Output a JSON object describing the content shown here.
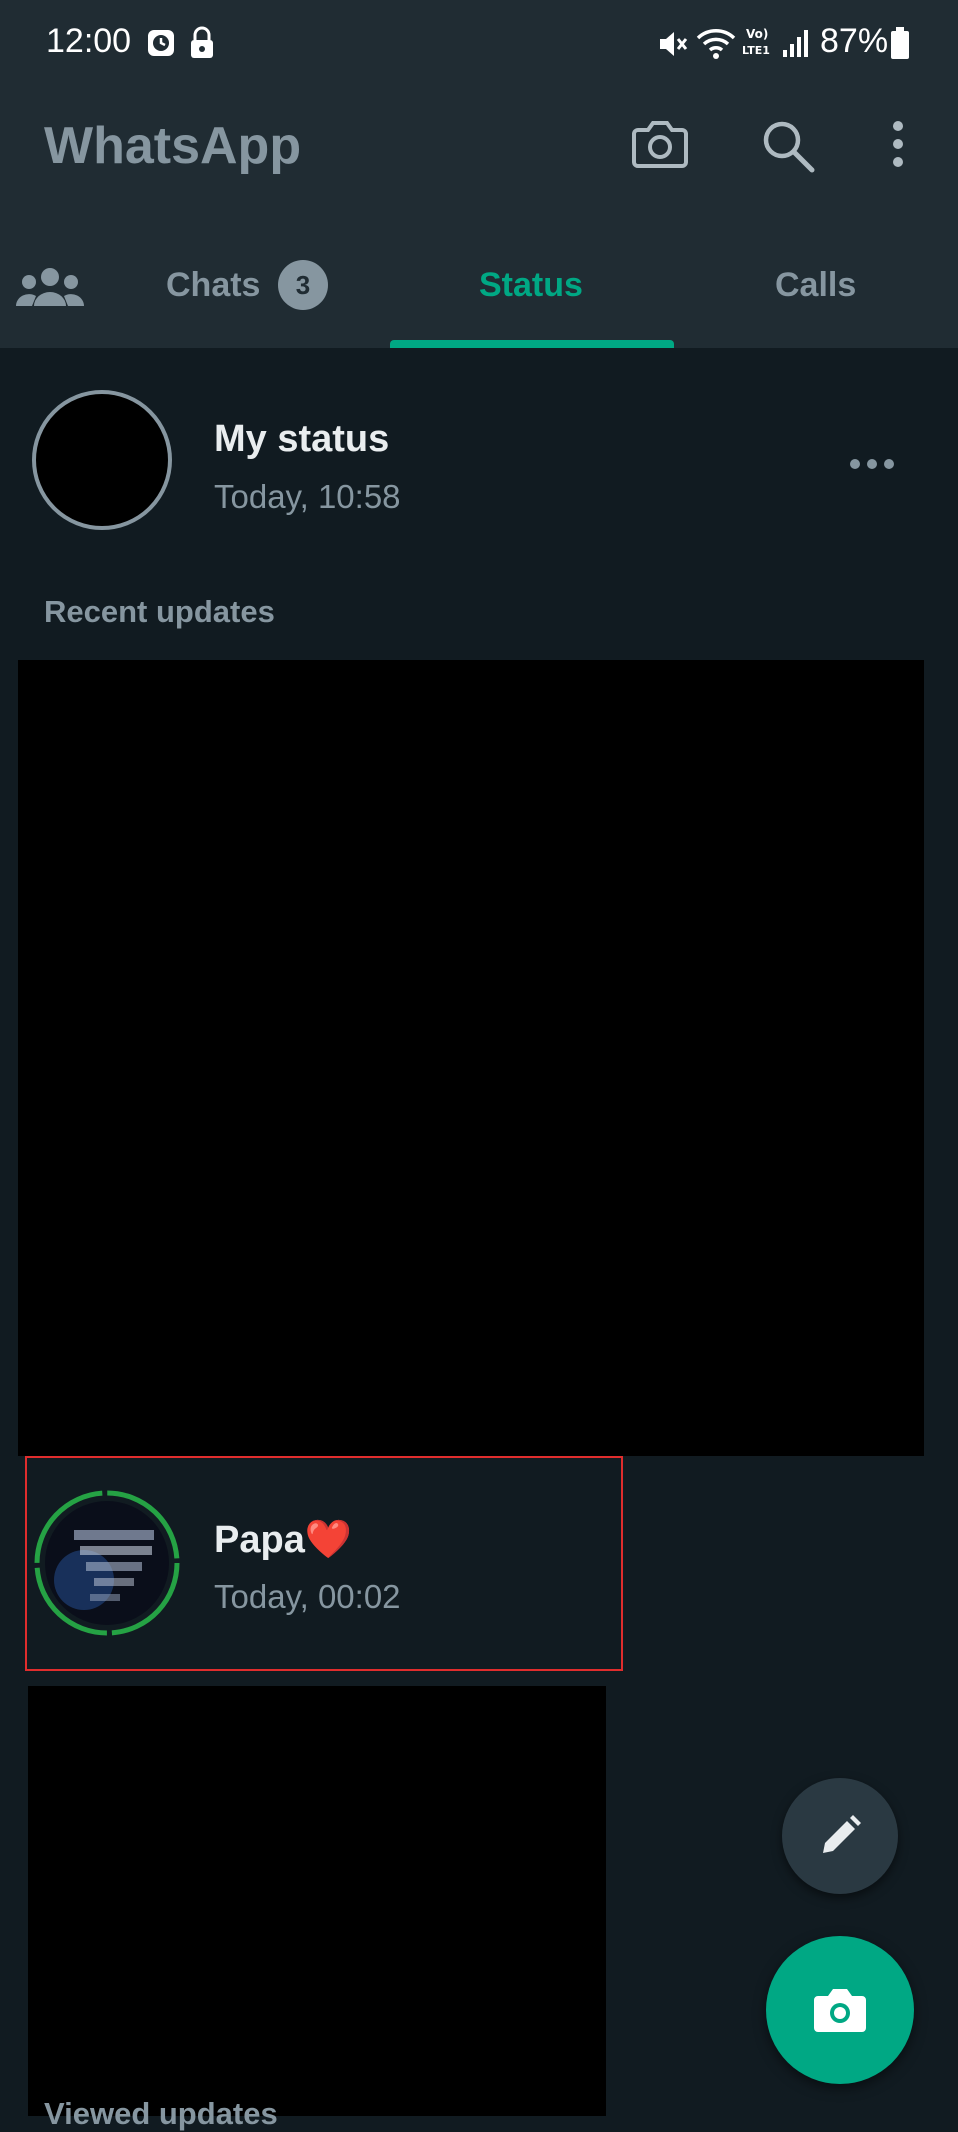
{
  "status_bar": {
    "time": "12:00",
    "battery": "87%",
    "icons": [
      "alarm-icon",
      "lock-icon",
      "mute-icon",
      "wifi-icon",
      "volte-icon",
      "signal-icon",
      "battery-icon"
    ]
  },
  "header": {
    "title": "WhatsApp",
    "actions": [
      "camera-icon",
      "search-icon",
      "more-vert-icon"
    ]
  },
  "tabs": {
    "communities_icon": "communities-icon",
    "chats": {
      "label": "Chats",
      "badge": "3"
    },
    "status": {
      "label": "Status"
    },
    "calls": {
      "label": "Calls"
    },
    "active": "Status"
  },
  "my_status": {
    "name": "My status",
    "time": "Today, 10:58"
  },
  "recent": {
    "label": "Recent updates",
    "items": [
      {
        "name": "Papa❤️",
        "time": "Today, 00:02"
      }
    ]
  },
  "viewed": {
    "label": "Viewed updates"
  },
  "colors": {
    "background": "#111b21",
    "header": "#202c33",
    "accent": "#00a884",
    "secondary_text": "#8696a0",
    "highlight": "#e02d2d"
  }
}
